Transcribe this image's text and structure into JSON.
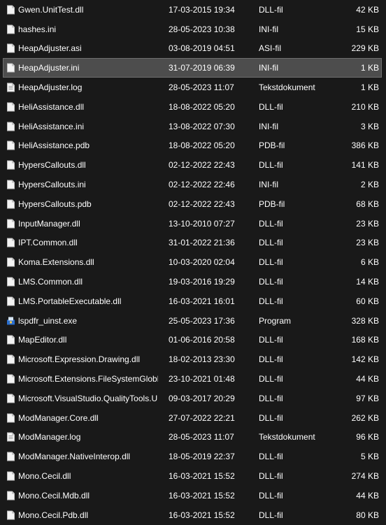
{
  "colors": {
    "background": "#191919",
    "text": "#ffffff",
    "selected_row_bg": "#4d4d4d",
    "selected_row_border": "#6f6f6f"
  },
  "files": [
    {
      "name": "Gwen.UnitTest.dll",
      "modified": "17-03-2015 19:34",
      "type": "DLL-fil",
      "size": "42 KB",
      "icon": "file-icon"
    },
    {
      "name": "hashes.ini",
      "modified": "28-05-2023 10:38",
      "type": "INI-fil",
      "size": "15 KB",
      "icon": "file-icon"
    },
    {
      "name": "HeapAdjuster.asi",
      "modified": "03-08-2019 04:51",
      "type": "ASI-fil",
      "size": "229 KB",
      "icon": "file-icon"
    },
    {
      "name": "HeapAdjuster.ini",
      "modified": "31-07-2019 06:39",
      "type": "INI-fil",
      "size": "1 KB",
      "icon": "file-icon",
      "selected": true
    },
    {
      "name": "HeapAdjuster.log",
      "modified": "28-05-2023 11:07",
      "type": "Tekstdokument",
      "size": "1 KB",
      "icon": "text-document-icon"
    },
    {
      "name": "HeliAssistance.dll",
      "modified": "18-08-2022 05:20",
      "type": "DLL-fil",
      "size": "210 KB",
      "icon": "file-icon"
    },
    {
      "name": "HeliAssistance.ini",
      "modified": "13-08-2022 07:30",
      "type": "INI-fil",
      "size": "3 KB",
      "icon": "file-icon"
    },
    {
      "name": "HeliAssistance.pdb",
      "modified": "18-08-2022 05:20",
      "type": "PDB-fil",
      "size": "386 KB",
      "icon": "file-icon"
    },
    {
      "name": "HypersCallouts.dll",
      "modified": "02-12-2022 22:43",
      "type": "DLL-fil",
      "size": "141 KB",
      "icon": "file-icon"
    },
    {
      "name": "HypersCallouts.ini",
      "modified": "02-12-2022 22:46",
      "type": "INI-fil",
      "size": "2 KB",
      "icon": "file-icon"
    },
    {
      "name": "HypersCallouts.pdb",
      "modified": "02-12-2022 22:43",
      "type": "PDB-fil",
      "size": "68 KB",
      "icon": "file-icon"
    },
    {
      "name": "InputManager.dll",
      "modified": "13-10-2010 07:27",
      "type": "DLL-fil",
      "size": "23 KB",
      "icon": "file-icon"
    },
    {
      "name": "IPT.Common.dll",
      "modified": "31-01-2022 21:36",
      "type": "DLL-fil",
      "size": "23 KB",
      "icon": "file-icon"
    },
    {
      "name": "Koma.Extensions.dll",
      "modified": "10-03-2020 02:04",
      "type": "DLL-fil",
      "size": "6 KB",
      "icon": "file-icon"
    },
    {
      "name": "LMS.Common.dll",
      "modified": "19-03-2016 19:29",
      "type": "DLL-fil",
      "size": "14 KB",
      "icon": "file-icon"
    },
    {
      "name": "LMS.PortableExecutable.dll",
      "modified": "16-03-2021 16:01",
      "type": "DLL-fil",
      "size": "60 KB",
      "icon": "file-icon"
    },
    {
      "name": "lspdfr_uinst.exe",
      "modified": "25-05-2023 17:36",
      "type": "Program",
      "size": "328 KB",
      "icon": "installer-icon"
    },
    {
      "name": "MapEditor.dll",
      "modified": "01-06-2016 20:58",
      "type": "DLL-fil",
      "size": "168 KB",
      "icon": "file-icon"
    },
    {
      "name": "Microsoft.Expression.Drawing.dll",
      "modified": "18-02-2013 23:30",
      "type": "DLL-fil",
      "size": "142 KB",
      "icon": "file-icon"
    },
    {
      "name": "Microsoft.Extensions.FileSystemGlobbin...",
      "modified": "23-10-2021 01:48",
      "type": "DLL-fil",
      "size": "44 KB",
      "icon": "file-icon"
    },
    {
      "name": "Microsoft.VisualStudio.QualityTools.Unit...",
      "modified": "09-03-2017 20:29",
      "type": "DLL-fil",
      "size": "97 KB",
      "icon": "file-icon"
    },
    {
      "name": "ModManager.Core.dll",
      "modified": "27-07-2022 22:21",
      "type": "DLL-fil",
      "size": "262 KB",
      "icon": "file-icon"
    },
    {
      "name": "ModManager.log",
      "modified": "28-05-2023 11:07",
      "type": "Tekstdokument",
      "size": "96 KB",
      "icon": "text-document-icon"
    },
    {
      "name": "ModManager.NativeInterop.dll",
      "modified": "18-05-2019 22:37",
      "type": "DLL-fil",
      "size": "5 KB",
      "icon": "file-icon"
    },
    {
      "name": "Mono.Cecil.dll",
      "modified": "16-03-2021 15:52",
      "type": "DLL-fil",
      "size": "274 KB",
      "icon": "file-icon"
    },
    {
      "name": "Mono.Cecil.Mdb.dll",
      "modified": "16-03-2021 15:52",
      "type": "DLL-fil",
      "size": "44 KB",
      "icon": "file-icon"
    },
    {
      "name": "Mono.Cecil.Pdb.dll",
      "modified": "16-03-2021 15:52",
      "type": "DLL-fil",
      "size": "80 KB",
      "icon": "file-icon"
    }
  ]
}
